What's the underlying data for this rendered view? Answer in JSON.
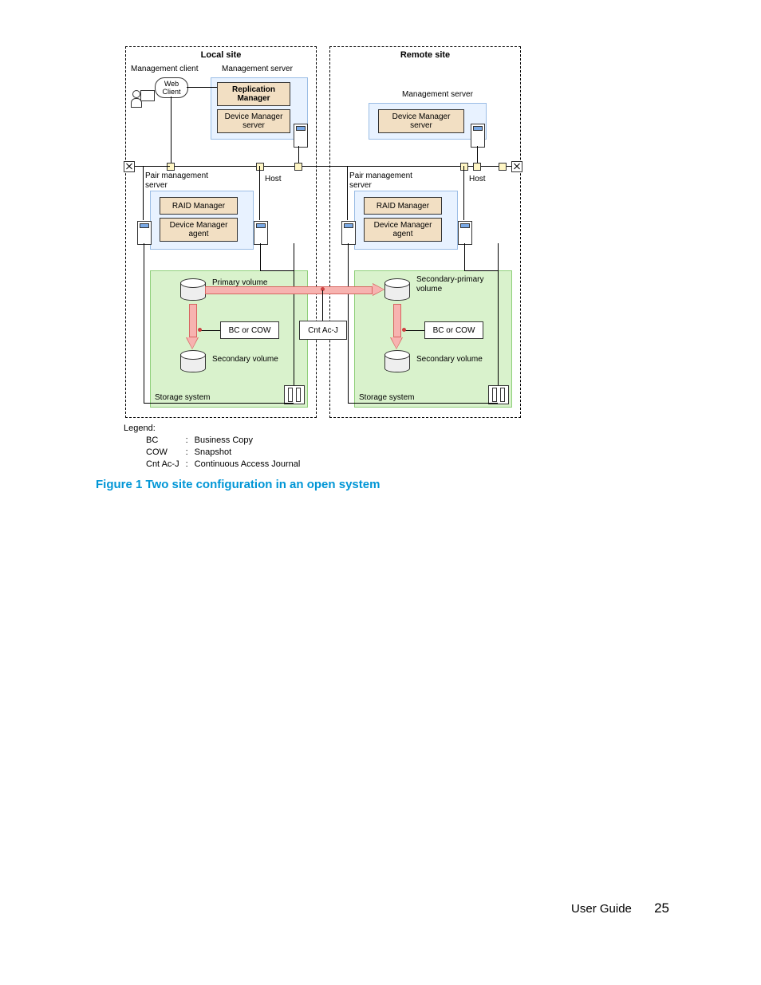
{
  "diagram": {
    "sites": {
      "local": {
        "title": "Local site",
        "management_client": "Management client",
        "management_server": "Management server",
        "web_client": "Web\nClient",
        "replication_manager": "Replication\nManager",
        "device_manager_server": "Device Manager\nserver",
        "pair_mgmt_server": "Pair management\nserver",
        "host": "Host",
        "raid_manager": "RAID Manager",
        "device_manager_agent": "Device Manager\nagent",
        "primary_volume": "Primary volume",
        "bc_or_cow": "BC or COW",
        "secondary_volume": "Secondary volume",
        "storage_system": "Storage system"
      },
      "remote": {
        "title": "Remote site",
        "management_server": "Management server",
        "device_manager_server": "Device Manager\nserver",
        "pair_mgmt_server": "Pair management\nserver",
        "host": "Host",
        "raid_manager": "RAID Manager",
        "device_manager_agent": "Device Manager\nagent",
        "secondary_primary_volume": "Secondary-primary\nvolume",
        "bc_or_cow": "BC or COW",
        "secondary_volume": "Secondary volume",
        "storage_system": "Storage system"
      }
    },
    "cnt_ac_j": "Cnt Ac-J"
  },
  "legend": {
    "heading": "Legend:",
    "rows": [
      {
        "abbr": "BC",
        "colon": ":",
        "desc": "Business Copy"
      },
      {
        "abbr": "COW",
        "colon": ":",
        "desc": "Snapshot"
      },
      {
        "abbr": "Cnt Ac-J",
        "colon": ":",
        "desc": "Continuous Access Journal"
      }
    ]
  },
  "caption": "Figure 1 Two site configuration in an open system",
  "footer": {
    "doc": "User Guide",
    "page": "25"
  }
}
